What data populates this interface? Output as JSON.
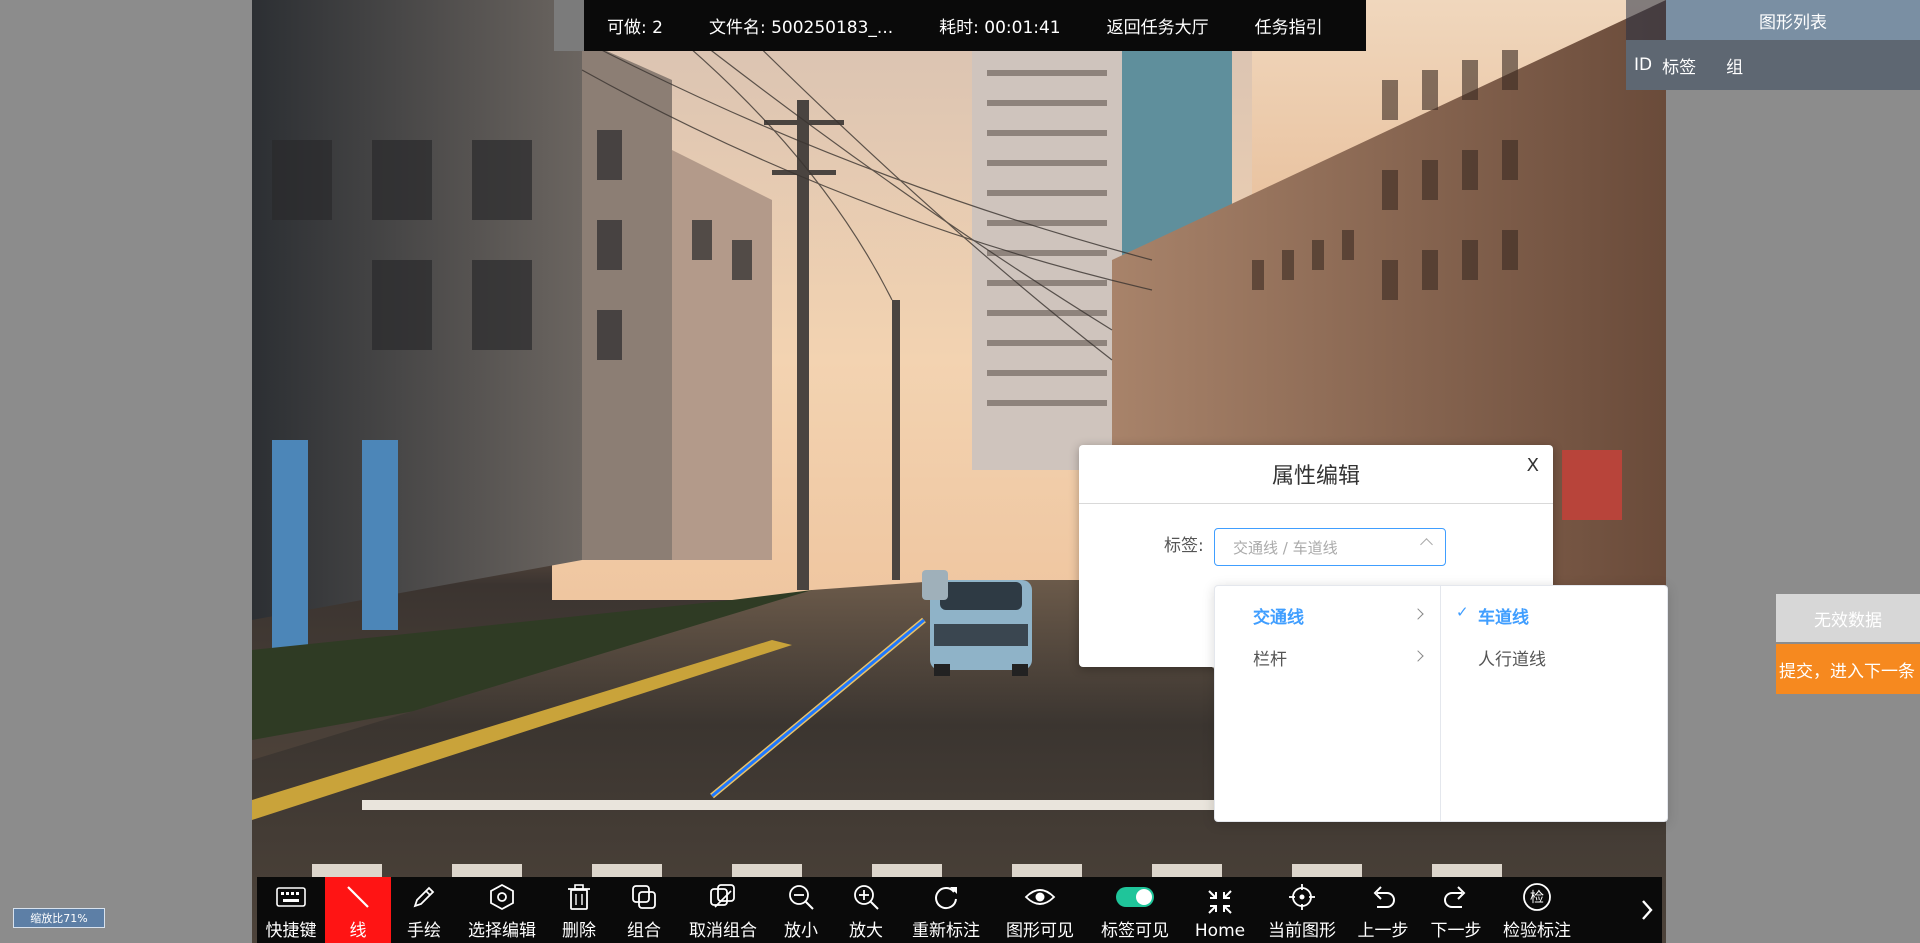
{
  "topbar": {
    "can_do": "可做: 2",
    "filename": "文件名: 500250183_...",
    "elapsed": "耗时: 00:01:41",
    "back_to_hall": "返回任务大厅",
    "task_guide": "任务指引"
  },
  "shape_list": {
    "title": "图形列表",
    "col_id": "ID",
    "col_label": "标签",
    "col_group": "组"
  },
  "side_buttons": {
    "invalid": "无效数据",
    "submit_next": "提交，进入下一条"
  },
  "dialog": {
    "title": "属性编辑",
    "close": "X",
    "label_text": "标签:",
    "select_placeholder": "交通线 / 车道线"
  },
  "cascader": {
    "level1": [
      {
        "label": "交通线",
        "active": true
      },
      {
        "label": "栏杆",
        "active": false
      }
    ],
    "level2": [
      {
        "label": "车道线",
        "selected": true
      },
      {
        "label": "人行道线",
        "selected": false
      }
    ],
    "check": "✓"
  },
  "toolbar": {
    "items": [
      {
        "label": "快捷键",
        "icon": "keyboard-icon"
      },
      {
        "label": "线",
        "icon": "line-icon",
        "active": true
      },
      {
        "label": "手绘",
        "icon": "pencil-icon"
      },
      {
        "label": "选择编辑",
        "icon": "hexagon-icon"
      },
      {
        "label": "删除",
        "icon": "trash-icon"
      },
      {
        "label": "组合",
        "icon": "group-icon"
      },
      {
        "label": "取消组合",
        "icon": "ungroup-icon"
      },
      {
        "label": "放小",
        "icon": "zoom-out-icon"
      },
      {
        "label": "放大",
        "icon": "zoom-in-icon"
      },
      {
        "label": "重新标注",
        "icon": "redo-circle-icon"
      },
      {
        "label": "图形可见",
        "icon": "eye-icon"
      },
      {
        "label": "标签可见",
        "icon": "toggle-icon"
      },
      {
        "label": "Home",
        "icon": "compress-icon"
      },
      {
        "label": "当前图形",
        "icon": "crosshair-icon"
      },
      {
        "label": "上一步",
        "icon": "undo-icon"
      },
      {
        "label": "下一步",
        "icon": "redo-icon"
      },
      {
        "label": "检验标注",
        "icon": "check-stamp-icon",
        "glyph": "检"
      }
    ]
  },
  "zoom": {
    "label": "缩放比71%"
  }
}
